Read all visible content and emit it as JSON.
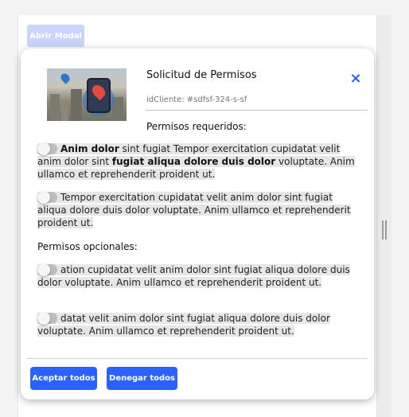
{
  "page": {
    "open_modal_label": "Abrir Modal"
  },
  "modal": {
    "title": "Solicitud de Permisos",
    "close_icon": "×",
    "client_id_placeholder": "idCliente: #sdfsf-324-s-sf",
    "required_title": "Permisos requeridos:",
    "optional_title": "Permisos opcionales:",
    "required": [
      {
        "bold_lead": "Anim dolor",
        "text_a": " sint fugiat Tempor exercitation cupidatat velit anim dolor sint ",
        "bold_mid": "fugiat aliqua dolore duis dolor",
        "text_b": " voluptate. Anim ullamco et reprehenderit proident ut.",
        "enabled": false
      },
      {
        "text": "Tempor exercitation cupidatat velit anim dolor sint fugiat aliqua dolore duis dolor voluptate. Anim ullamco et reprehenderit proident ut.",
        "enabled": false
      }
    ],
    "optional": [
      {
        "text": "ation cupidatat velit anim dolor sint fugiat aliqua dolore duis dolor voluptate. Anim ullamco et reprehenderit proident ut.",
        "enabled": false
      },
      {
        "text": "datat velit anim dolor sint fugiat aliqua dolore duis dolor voluptate. Anim ullamco et reprehenderit proident ut.",
        "enabled": false
      }
    ],
    "accept_all_label": "Aceptar todos",
    "deny_all_label": "Denegar todos"
  },
  "colors": {
    "primary": "#2962ff",
    "close_icon": "#2f5ee6",
    "disabled_button": "#c9d5fb",
    "toggle_off": "#bdbdbd",
    "text_highlight": "#e6e6e6"
  },
  "icons": [
    "close-icon",
    "location-pin-icon"
  ]
}
